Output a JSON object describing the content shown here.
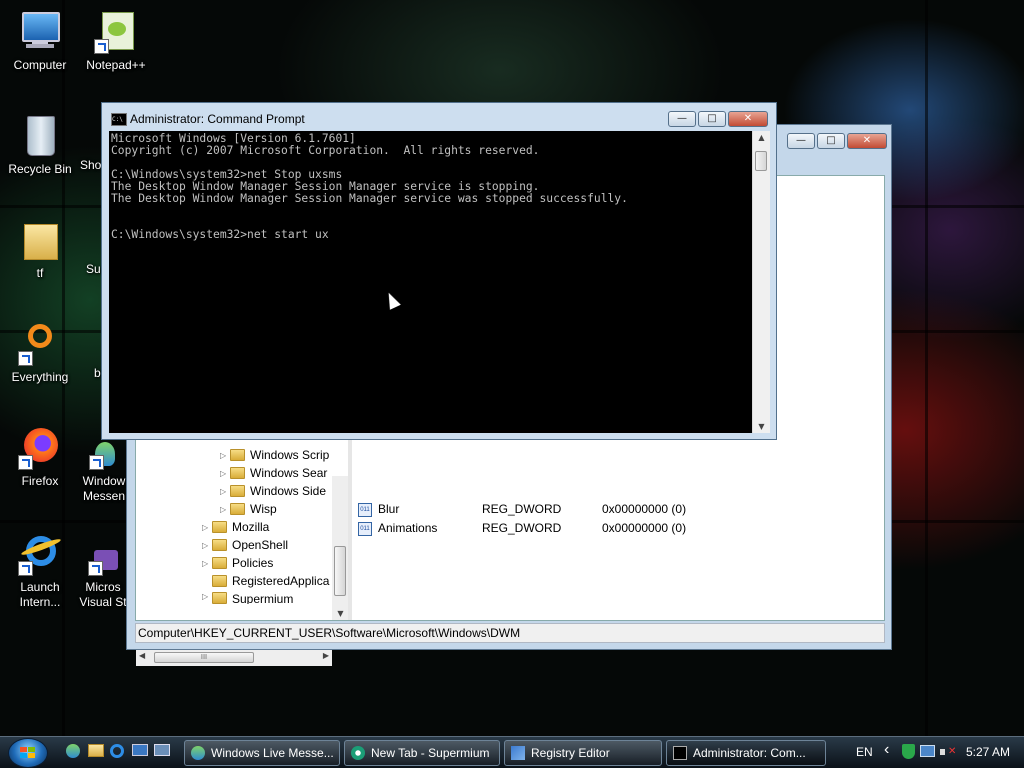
{
  "desktop": {
    "icons": [
      {
        "label": "Computer"
      },
      {
        "label": "Notepad++"
      },
      {
        "label": "Recycle Bin"
      },
      {
        "label": "Sho"
      },
      {
        "label": "tf"
      },
      {
        "label": "Su"
      },
      {
        "label": "Everything"
      },
      {
        "label": "b"
      },
      {
        "label": "Firefox"
      },
      {
        "label": "Window\nMessen"
      },
      {
        "label": "Launch\nIntern..."
      },
      {
        "label": "Micros\nVisual St"
      }
    ]
  },
  "registry_editor": {
    "tree": [
      {
        "label": "Windows Scrip"
      },
      {
        "label": "Windows Sear"
      },
      {
        "label": "Windows Side"
      },
      {
        "label": "Wisp"
      },
      {
        "label": "Mozilla"
      },
      {
        "label": "OpenShell"
      },
      {
        "label": "Policies"
      },
      {
        "label": "RegisteredApplica"
      },
      {
        "label": "Supermium"
      }
    ],
    "values": [
      {
        "name": "Blur",
        "type": "REG_DWORD",
        "data": "0x00000000 (0)"
      },
      {
        "name": "Animations",
        "type": "REG_DWORD",
        "data": "0x00000000 (0)"
      }
    ],
    "status_path": "Computer\\HKEY_CURRENT_USER\\Software\\Microsoft\\Windows\\DWM",
    "hscroll_grip": "III"
  },
  "command_prompt": {
    "title": "Administrator: Command Prompt",
    "icon_text": "C:\\",
    "console_text": "Microsoft Windows [Version 6.1.7601]\nCopyright (c) 2007 Microsoft Corporation.  All rights reserved.\n\nC:\\Windows\\system32>net Stop uxsms\nThe Desktop Window Manager Session Manager service is stopping.\nThe Desktop Window Manager Session Manager service was stopped successfully.\n\n\nC:\\Windows\\system32>net start ux"
  },
  "window_controls": {
    "minimize": "—",
    "maximize": "□",
    "close": "✕"
  },
  "taskbar": {
    "buttons": [
      {
        "label": "Windows Live Messe..."
      },
      {
        "label": "New Tab - Supermium"
      },
      {
        "label": "Registry Editor"
      },
      {
        "label": "Administrator: Com..."
      }
    ],
    "language": "EN",
    "clock": "5:27 AM",
    "tray_chevron": "‹"
  }
}
